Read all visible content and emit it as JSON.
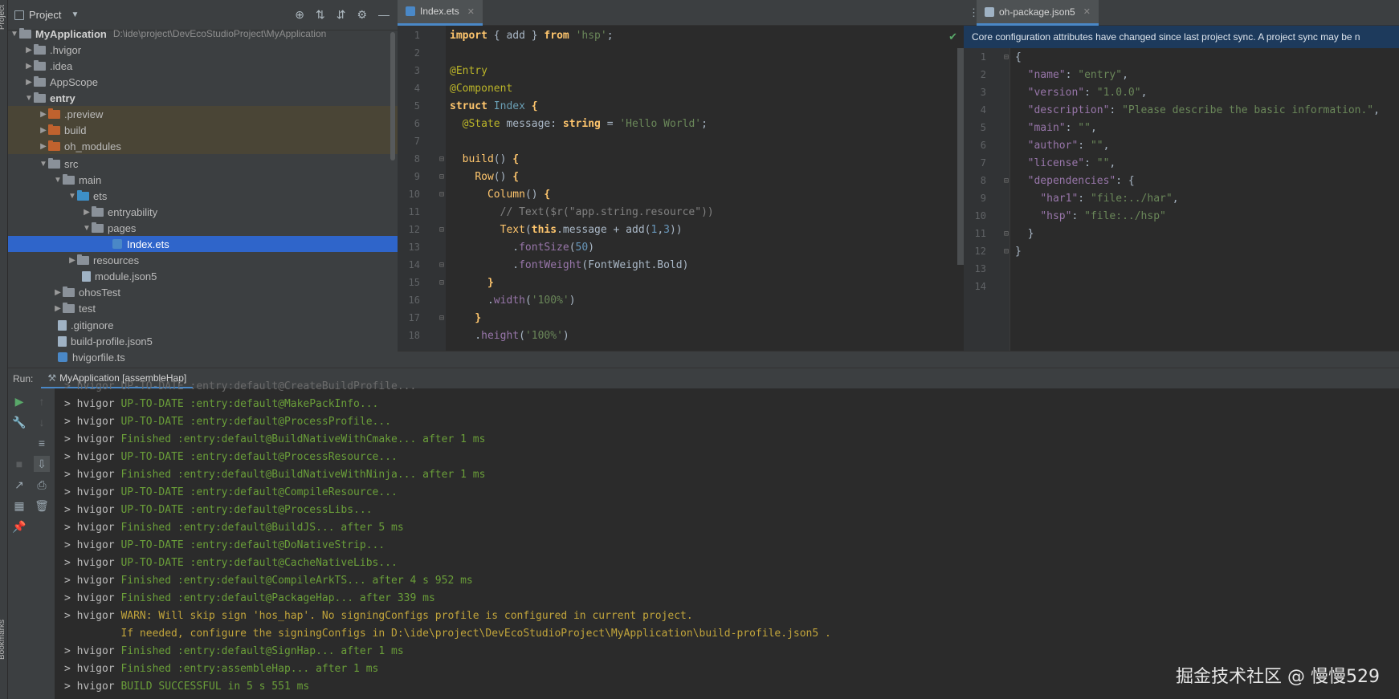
{
  "left_strip": {
    "project_label": "Project",
    "bookmarks_label": "Bookmarks"
  },
  "project_panel": {
    "title": "Project",
    "tree": [
      {
        "label": "MyApplication",
        "path": "D:\\ide\\project\\DevEcoStudioProject\\MyApplication",
        "bold": true
      },
      {
        "label": ".hvigor"
      },
      {
        "label": ".idea"
      },
      {
        "label": "AppScope"
      },
      {
        "label": "entry",
        "bold": true
      },
      {
        "label": ".preview"
      },
      {
        "label": "build"
      },
      {
        "label": "oh_modules"
      },
      {
        "label": "src"
      },
      {
        "label": "main"
      },
      {
        "label": "ets"
      },
      {
        "label": "entryability"
      },
      {
        "label": "pages"
      },
      {
        "label": "Index.ets"
      },
      {
        "label": "resources"
      },
      {
        "label": "module.json5"
      },
      {
        "label": "ohosTest"
      },
      {
        "label": "test"
      },
      {
        "label": ".gitignore"
      },
      {
        "label": "build-profile.json5"
      },
      {
        "label": "hvigorfile.ts"
      }
    ]
  },
  "editor1": {
    "tab_label": "Index.ets",
    "line_numbers": [
      "1",
      "2",
      "3",
      "4",
      "5",
      "6",
      "7",
      "8",
      "9",
      "10",
      "11",
      "12",
      "13",
      "14",
      "15",
      "16",
      "17",
      "18"
    ]
  },
  "editor2": {
    "tab_label": "oh-package.json5",
    "banner": "Core configuration attributes have changed since last project sync. A project sync may be n",
    "line_numbers": [
      "1",
      "2",
      "3",
      "4",
      "5",
      "6",
      "7",
      "8",
      "9",
      "10",
      "11",
      "12",
      "13",
      "14"
    ]
  },
  "run_panel": {
    "label": "Run:",
    "tab_label": "MyApplication [assembleHap]",
    "partial_top_line": "> hvigor UP-TO-DATE :entry:default@CreateBuildProfile...",
    "lines": [
      {
        "prompt": "> hvigor ",
        "status": "UP-TO-DATE :entry:default@MakePackInfo...",
        "kind": "green"
      },
      {
        "prompt": "> hvigor ",
        "status": "UP-TO-DATE :entry:default@ProcessProfile...",
        "kind": "green"
      },
      {
        "prompt": "> hvigor ",
        "status": "Finished :entry:default@BuildNativeWithCmake... after 1 ms",
        "kind": "green"
      },
      {
        "prompt": "> hvigor ",
        "status": "UP-TO-DATE :entry:default@ProcessResource...",
        "kind": "green"
      },
      {
        "prompt": "> hvigor ",
        "status": "Finished :entry:default@BuildNativeWithNinja... after 1 ms",
        "kind": "green"
      },
      {
        "prompt": "> hvigor ",
        "status": "UP-TO-DATE :entry:default@CompileResource...",
        "kind": "green"
      },
      {
        "prompt": "> hvigor ",
        "status": "UP-TO-DATE :entry:default@ProcessLibs...",
        "kind": "green"
      },
      {
        "prompt": "> hvigor ",
        "status": "Finished :entry:default@BuildJS... after 5 ms",
        "kind": "green"
      },
      {
        "prompt": "> hvigor ",
        "status": "UP-TO-DATE :entry:default@DoNativeStrip...",
        "kind": "green"
      },
      {
        "prompt": "> hvigor ",
        "status": "UP-TO-DATE :entry:default@CacheNativeLibs...",
        "kind": "green"
      },
      {
        "prompt": "> hvigor ",
        "status": "Finished :entry:default@CompileArkTS... after 4 s 952 ms",
        "kind": "green"
      },
      {
        "prompt": "> hvigor ",
        "status": "Finished :entry:default@PackageHap... after 339 ms",
        "kind": "green"
      },
      {
        "prompt": "> hvigor ",
        "status": "WARN: Will skip sign 'hos_hap'. No signingConfigs profile is configured in current project.",
        "kind": "warn"
      },
      {
        "prompt": "",
        "status": "         If needed, configure the signingConfigs in D:\\ide\\project\\DevEcoStudioProject\\MyApplication\\build-profile.json5 .",
        "kind": "warn"
      },
      {
        "prompt": "> hvigor ",
        "status": "Finished :entry:default@SignHap... after 1 ms",
        "kind": "green"
      },
      {
        "prompt": "> hvigor ",
        "status": "Finished :entry:assembleHap... after 1 ms",
        "kind": "green"
      },
      {
        "prompt": "> hvigor ",
        "status": "BUILD SUCCESSFUL in 5 s 551 ms",
        "kind": "green"
      }
    ]
  },
  "watermark": "掘金技术社区 @ 慢慢529",
  "colors": {
    "selection": "#2f65ca",
    "accent": "#4a88c7",
    "success_text": "#6a9e39",
    "warn_text": "#c1a43b"
  }
}
